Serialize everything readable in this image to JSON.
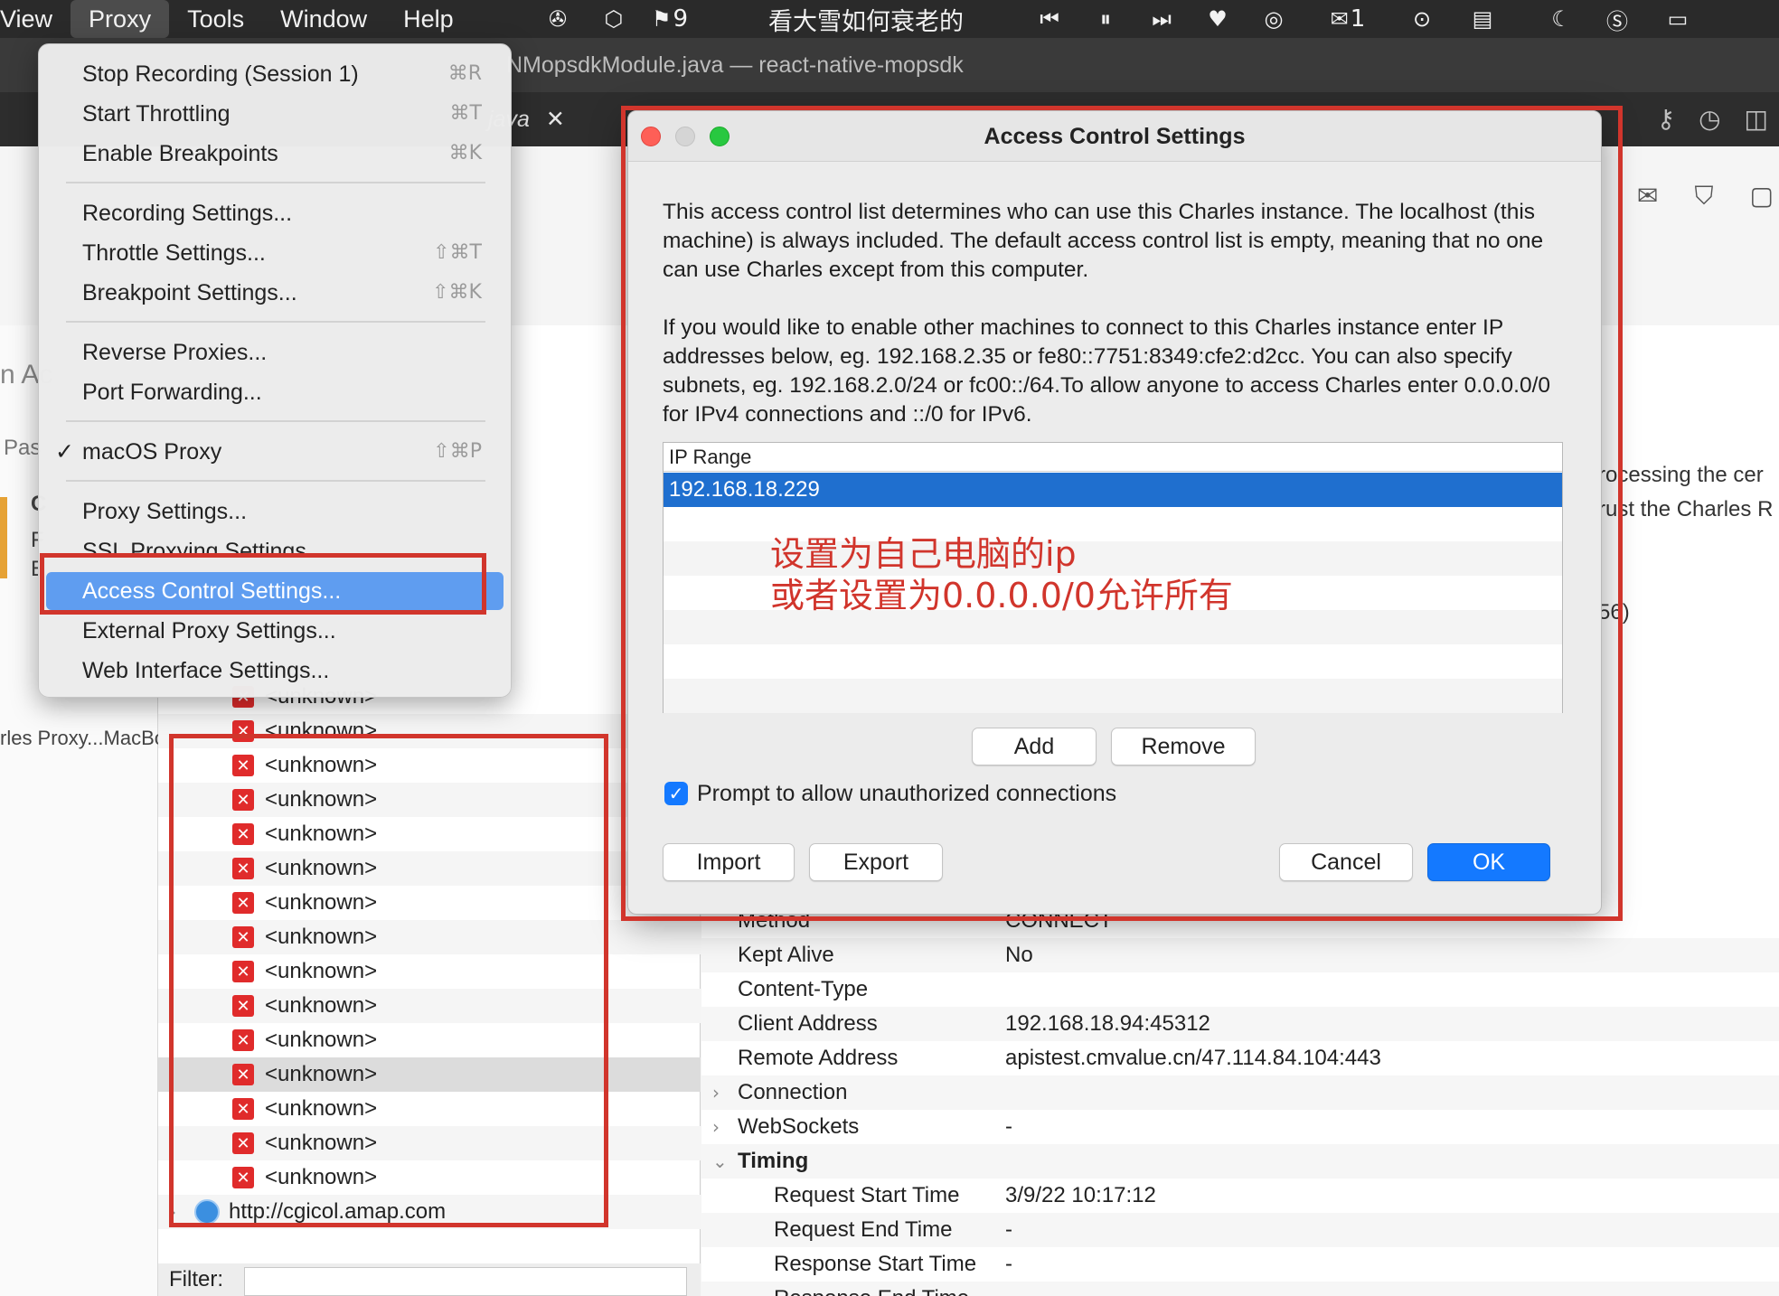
{
  "menubar": {
    "items": [
      "View",
      "Proxy",
      "Tools",
      "Window",
      "Help"
    ],
    "badge_count": "9",
    "now_playing": "看大雪如何衰老的",
    "wechat_count": "1"
  },
  "editor": {
    "window_title": "NMopsdkModule.java — react-native-mopsdk",
    "tab_label": "java"
  },
  "proxy_menu": {
    "items": [
      {
        "label": "Stop Recording (Session 1)",
        "shortcut": "⌘R"
      },
      {
        "label": "Start Throttling",
        "shortcut": "⌘T"
      },
      {
        "label": "Enable Breakpoints",
        "shortcut": "⌘K"
      },
      {
        "label": "Recording Settings..."
      },
      {
        "label": "Throttle Settings...",
        "shortcut": "⇧⌘T"
      },
      {
        "label": "Breakpoint Settings...",
        "shortcut": "⇧⌘K"
      },
      {
        "label": "Reverse Proxies..."
      },
      {
        "label": "Port Forwarding..."
      },
      {
        "label": "macOS Proxy",
        "shortcut": "⇧⌘P",
        "checked": "✓"
      },
      {
        "label": "Proxy Settings..."
      },
      {
        "label": "SSL Proxying Settings..."
      },
      {
        "label": "Access Control Settings..."
      },
      {
        "label": "External Proxy Settings..."
      },
      {
        "label": "Web Interface Settings..."
      }
    ]
  },
  "dialog": {
    "title": "Access Control Settings",
    "para1": "This access control list determines who can use this Charles instance. The localhost (this machine) is always included. The default access control list is empty, meaning that no one can use Charles except from this computer.",
    "para2": "If you would like to enable other machines to connect to this Charles instance enter IP addresses below, eg. 192.168.2.35 or fe80::7751:8349:cfe2:d2cc. You can also specify subnets, eg. 192.168.2.0/24 or fc00::/64.To allow anyone to access Charles enter 0.0.0.0/0 for IPv4 connections and ::/0 for IPv6.",
    "table_header": "IP Range",
    "ip_rows": [
      "192.168.18.229"
    ],
    "annotation_line1": "设置为自己电脑的ip",
    "annotation_line2": "或者设置为0.0.0.0/0允许所有",
    "add_label": "Add",
    "remove_label": "Remove",
    "checkbox_label": "Prompt to allow unauthorized connections",
    "import_label": "Import",
    "export_label": "Export",
    "cancel_label": "Cancel",
    "ok_label": "OK"
  },
  "sidebar": {
    "frag_ac": "n Ac",
    "frag_pas": "Pas",
    "frag_c": "C",
    "frag_f": "F",
    "frag_e": "E",
    "frag_proxy": "rles Proxy...MacBo"
  },
  "tree": {
    "unknown_label": "<unknown>",
    "host_row": "http://cgicol.amap.com",
    "filter_label": "Filter:"
  },
  "details": {
    "frag1": "rocessing the cer",
    "frag2": "rust the Charles R",
    "frag3": "56)",
    "method_key": "Method",
    "method_val": "CONNECT",
    "rows": [
      {
        "k": "Kept Alive",
        "v": "No"
      },
      {
        "k": "Content-Type",
        "v": ""
      },
      {
        "k": "Client Address",
        "v": "192.168.18.94:45312"
      },
      {
        "k": "Remote Address",
        "v": "apistest.cmvalue.cn/47.114.84.104:443"
      },
      {
        "k": "Connection",
        "v": ""
      },
      {
        "k": "WebSockets",
        "v": "-"
      },
      {
        "k": "Timing",
        "v": ""
      },
      {
        "k": "Request Start Time",
        "v": "3/9/22 10:17:12"
      },
      {
        "k": "Request End Time",
        "v": "-"
      },
      {
        "k": "Response Start Time",
        "v": "-"
      },
      {
        "k": "Response End Time",
        "v": ""
      }
    ]
  },
  "colors": {
    "annotation_red": "#d1352c",
    "selection_blue": "#1f6fcf",
    "menu_highlight": "#5f9df0",
    "primary_button": "#1479ff"
  }
}
